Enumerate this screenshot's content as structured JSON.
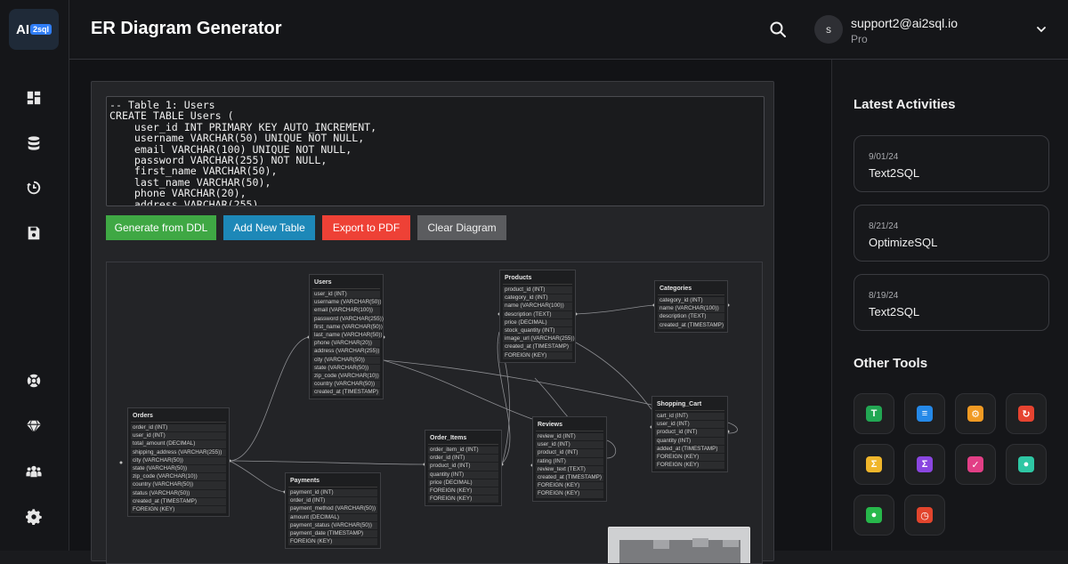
{
  "app": {
    "logo_ai": "AI",
    "logo_sql": "2sql",
    "page_title": "ER Diagram Generator"
  },
  "user": {
    "avatar_letter": "s",
    "email": "support2@ai2sql.io",
    "plan": "Pro"
  },
  "ddl_text": "-- Table 1: Users\nCREATE TABLE Users (\n    user_id INT PRIMARY KEY AUTO_INCREMENT,\n    username VARCHAR(50) UNIQUE NOT NULL,\n    email VARCHAR(100) UNIQUE NOT NULL,\n    password VARCHAR(255) NOT NULL,\n    first_name VARCHAR(50),\n    last_name VARCHAR(50),\n    phone VARCHAR(20),\n    address VARCHAR(255),",
  "buttons": {
    "generate": "Generate from DDL",
    "add_table": "Add New Table",
    "export": "Export to PDF",
    "clear": "Clear Diagram"
  },
  "er_tables": {
    "users": {
      "title": "Users",
      "fields": [
        "user_id (INT)",
        "username (VARCHAR(50))",
        "email (VARCHAR(100))",
        "password (VARCHAR(255))",
        "first_name (VARCHAR(50))",
        "last_name (VARCHAR(50))",
        "phone (VARCHAR(20))",
        "address (VARCHAR(255))",
        "city (VARCHAR(50))",
        "state (VARCHAR(50))",
        "zip_code (VARCHAR(10))",
        "country (VARCHAR(50))",
        "created_at (TIMESTAMP)"
      ]
    },
    "products": {
      "title": "Products",
      "fields": [
        "product_id (INT)",
        "category_id (INT)",
        "name (VARCHAR(100))",
        "description (TEXT)",
        "price (DECIMAL)",
        "stock_quantity (INT)",
        "image_url (VARCHAR(255))",
        "created_at (TIMESTAMP)",
        "FOREIGN (KEY)"
      ]
    },
    "categories": {
      "title": "Categories",
      "fields": [
        "category_id (INT)",
        "name (VARCHAR(100))",
        "description (TEXT)",
        "created_at (TIMESTAMP)"
      ]
    },
    "orders": {
      "title": "Orders",
      "fields": [
        "order_id (INT)",
        "user_id (INT)",
        "total_amount (DECIMAL)",
        "shipping_address (VARCHAR(255))",
        "city (VARCHAR(50))",
        "state (VARCHAR(50))",
        "zip_code (VARCHAR(10))",
        "country (VARCHAR(50))",
        "status (VARCHAR(50))",
        "created_at (TIMESTAMP)",
        "FOREIGN (KEY)"
      ]
    },
    "order_items": {
      "title": "Order_Items",
      "fields": [
        "order_item_id (INT)",
        "order_id (INT)",
        "product_id (INT)",
        "quantity (INT)",
        "price (DECIMAL)",
        "FOREIGN (KEY)",
        "FOREIGN (KEY)"
      ]
    },
    "reviews": {
      "title": "Reviews",
      "fields": [
        "review_id (INT)",
        "user_id (INT)",
        "product_id (INT)",
        "rating (INT)",
        "review_text (TEXT)",
        "created_at (TIMESTAMP)",
        "FOREIGN (KEY)",
        "FOREIGN (KEY)"
      ]
    },
    "shopping_cart": {
      "title": "Shopping_Cart",
      "fields": [
        "cart_id (INT)",
        "user_id (INT)",
        "product_id (INT)",
        "quantity (INT)",
        "added_at (TIMESTAMP)",
        "FOREIGN (KEY)",
        "FOREIGN (KEY)"
      ]
    },
    "payments": {
      "title": "Payments",
      "fields": [
        "payment_id (INT)",
        "order_id (INT)",
        "payment_method (VARCHAR(50))",
        "amount (DECIMAL)",
        "payment_status (VARCHAR(50))",
        "payment_date (TIMESTAMP)",
        "FOREIGN (KEY)"
      ]
    }
  },
  "right_panel": {
    "latest_title": "Latest Activities",
    "activities": [
      {
        "date": "9/01/24",
        "name": "Text2SQL"
      },
      {
        "date": "8/21/24",
        "name": "OptimizeSQL"
      },
      {
        "date": "8/19/24",
        "name": "Text2SQL"
      }
    ],
    "tools_title": "Other Tools"
  },
  "colors": {
    "generate": "#3fa844",
    "add": "#1d88b8",
    "export": "#ee4136",
    "clear": "#5b5c5f"
  }
}
